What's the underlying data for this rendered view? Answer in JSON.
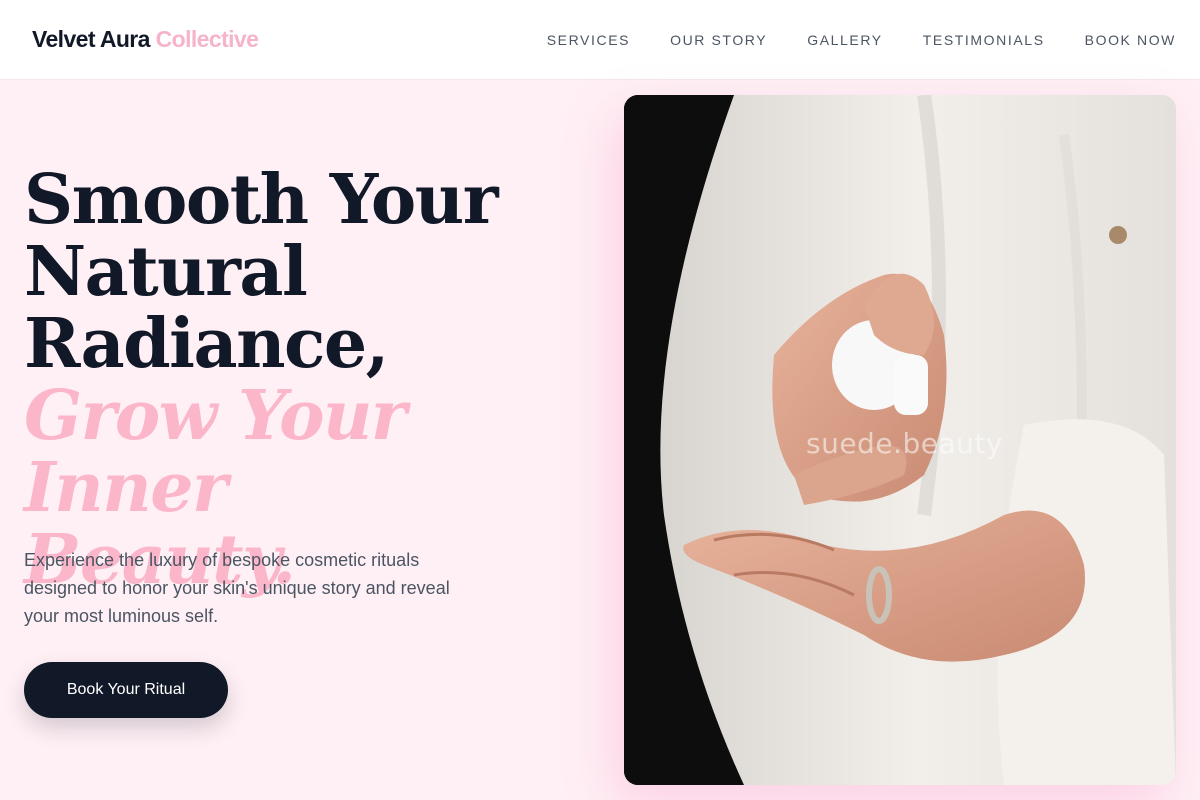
{
  "header": {
    "logo_main": "Velvet Aura",
    "logo_accent": "Collective",
    "nav": [
      "SERVICES",
      "OUR STORY",
      "GALLERY",
      "TESTIMONIALS",
      "BOOK NOW"
    ]
  },
  "hero": {
    "title_lines": [
      "Smooth Your",
      "Natural",
      "Radiance,"
    ],
    "accent_lines": [
      "Grow Your Inner",
      "Beauty."
    ],
    "subtitle": "Experience the luxury of bespoke cosmetic rituals designed to honor your skin's unique story and reveal your most luminous self.",
    "cta_label": "Book Your Ritual",
    "image_watermark": "suede.beauty"
  },
  "colors": {
    "brand_dark": "#111827",
    "brand_pink": "#fbb6ca",
    "page_bg": "#fff0f5"
  }
}
